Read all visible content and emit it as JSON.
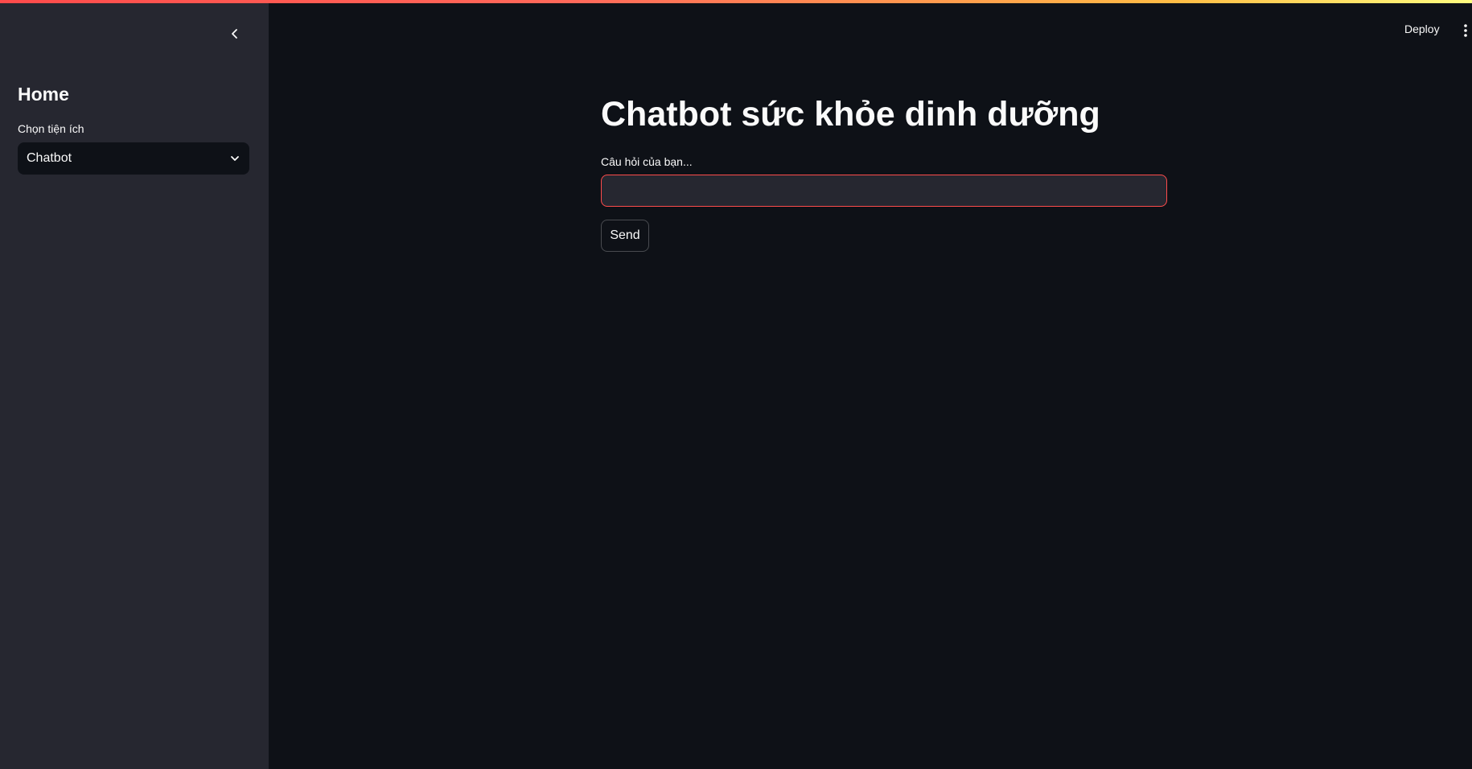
{
  "header": {
    "deploy_label": "Deploy",
    "menu_icon": "vertical-ellipsis-icon",
    "decoration_colors": [
      "#ff4b4b",
      "#ffbd45",
      "#fffd80"
    ]
  },
  "sidebar": {
    "collapse_icon": "chevron-left-icon",
    "title": "Home",
    "select_label": "Chọn tiện ích",
    "select_value": "Chatbot",
    "select_icon": "chevron-down-icon"
  },
  "main": {
    "title": "Chatbot sức khỏe dinh dưỡng",
    "input_label": "Câu hỏi của bạn...",
    "input_value": "",
    "send_label": "Send"
  },
  "colors": {
    "background": "#0e1117",
    "sidebar": "#262730",
    "accent": "#ff4b4b",
    "text": "#fafafa"
  }
}
